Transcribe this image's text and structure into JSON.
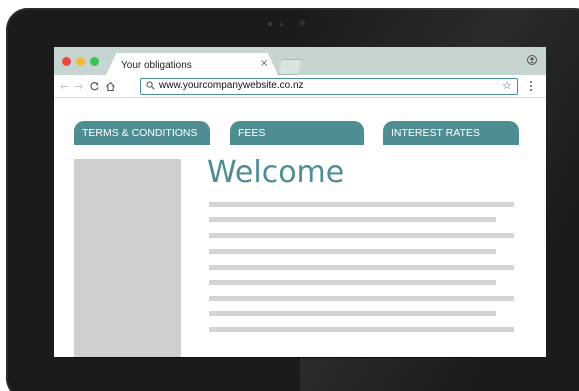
{
  "browser": {
    "tab_title": "Your obligations",
    "tab_close": "×",
    "url": "www.yourcompanywebsite.co.nz",
    "icons": {
      "back": "back-arrow-icon",
      "forward": "forward-arrow-icon",
      "reload": "reload-icon",
      "home": "home-icon",
      "search": "search-icon",
      "bookmark": "star-icon",
      "menu": "kebab-menu-icon",
      "profile": "profile-icon"
    }
  },
  "page": {
    "nav": [
      {
        "label": "TERMS & CONDITIONS"
      },
      {
        "label": "FEES"
      },
      {
        "label": "INTEREST RATES"
      }
    ],
    "title": "Welcome"
  },
  "colors": {
    "accent": "#4e8d92",
    "tabbar": "#c6d4d2",
    "placeholder": "#d4d4d4",
    "sidebar": "#d0d0d0",
    "device": "#1b1b1d"
  }
}
